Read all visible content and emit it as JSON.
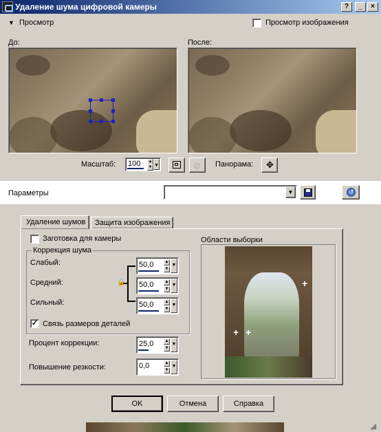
{
  "window": {
    "title": "Удаление шума цифровой камеры"
  },
  "titlebar_buttons": {
    "help": "?",
    "minimize": "_",
    "maximize": "□",
    "close": "×"
  },
  "preview_section": {
    "toggle_label": "Просмотр",
    "show_image_label": "Просмотр изображения",
    "show_image_checked": false,
    "before_label": "До:",
    "after_label": "После:"
  },
  "zoom": {
    "label": "Масштаб:",
    "value": "100",
    "pan_label": "Панорама:"
  },
  "params": {
    "label": "Параметры",
    "preset_value": ""
  },
  "tabs": [
    {
      "label": "Удаление шумов",
      "active": true
    },
    {
      "label": "Защита изображения",
      "active": false
    }
  ],
  "noise": {
    "camera_preset_label": "Заготовка для камеры",
    "camera_preset_checked": false,
    "group_title": "Коррекция шума",
    "weak_label": "Слабый:",
    "weak_value": "50,0",
    "medium_label": "Средний:",
    "medium_value": "50,0",
    "strong_label": "Сильный:",
    "strong_value": "50,0",
    "link_label": "Связь размеров деталей",
    "link_checked": true,
    "correction_label": "Процент коррекции:",
    "correction_value": "25,0",
    "sharpen_label": "Повышение резкости:",
    "sharpen_value": "0,0"
  },
  "samples": {
    "title": "Области выборки"
  },
  "footer": {
    "ok": "OK",
    "cancel": "Отмена",
    "help": "Справка"
  }
}
